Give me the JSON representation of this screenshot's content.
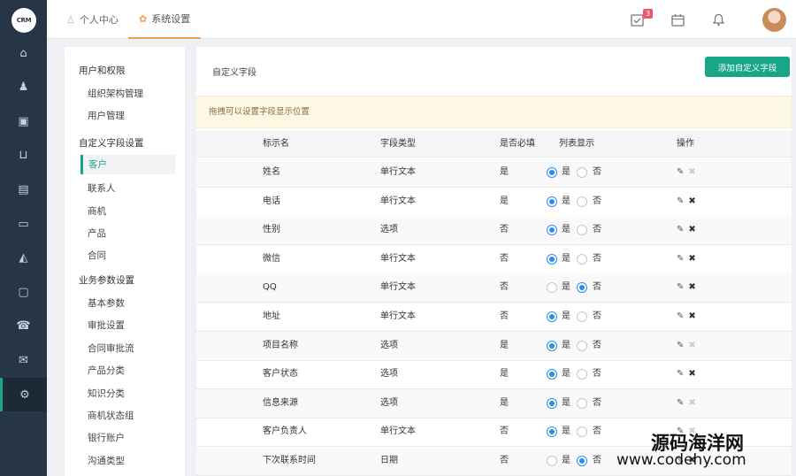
{
  "logo": "CRM",
  "topbar": {
    "tabs": [
      {
        "label": "个人中心",
        "icon": "user-icon"
      },
      {
        "label": "系统设置",
        "icon": "gear-icon"
      }
    ],
    "task_badge": "3",
    "icons": [
      "task-icon",
      "calendar-icon",
      "bell-icon"
    ]
  },
  "leftnav": [
    "home-icon",
    "user-icon",
    "briefcase-icon",
    "inbox-icon",
    "document-icon",
    "card-icon",
    "chart-icon",
    "monitor-icon",
    "phone-icon",
    "mail-icon",
    "gear-icon"
  ],
  "sidebar": {
    "groups": [
      {
        "title": "用户和权限",
        "items": [
          "组织架构管理",
          "用户管理"
        ]
      },
      {
        "title": "自定义字段设置",
        "items": [
          "客户",
          "联系人",
          "商机",
          "产品",
          "合同"
        ]
      },
      {
        "title": "业务参数设置",
        "items": [
          "基本参数",
          "审批设置",
          "合同审批流",
          "产品分类",
          "知识分类",
          "商机状态组",
          "银行账户",
          "沟通类型"
        ]
      }
    ],
    "selected": "客户"
  },
  "main": {
    "title": "自定义字段",
    "add_button": "添加自定义字段",
    "hint": "拖拽可以设置字段显示位置",
    "columns": [
      "标示名",
      "字段类型",
      "是否必填",
      "列表显示",
      "操作"
    ],
    "yes": "是",
    "no": "否",
    "rows": [
      {
        "name": "姓名",
        "type": "单行文本",
        "required": "是",
        "show": true,
        "deletable": false
      },
      {
        "name": "电话",
        "type": "单行文本",
        "required": "是",
        "show": true,
        "deletable": true
      },
      {
        "name": "性别",
        "type": "选项",
        "required": "否",
        "show": true,
        "deletable": true
      },
      {
        "name": "微信",
        "type": "单行文本",
        "required": "否",
        "show": true,
        "deletable": true
      },
      {
        "name": "QQ",
        "type": "单行文本",
        "required": "否",
        "show": false,
        "deletable": true
      },
      {
        "name": "地址",
        "type": "单行文本",
        "required": "否",
        "show": true,
        "deletable": true
      },
      {
        "name": "项目名称",
        "type": "选项",
        "required": "是",
        "show": true,
        "deletable": false
      },
      {
        "name": "客户状态",
        "type": "选项",
        "required": "是",
        "show": true,
        "deletable": true
      },
      {
        "name": "信息来源",
        "type": "选项",
        "required": "是",
        "show": true,
        "deletable": false
      },
      {
        "name": "客户负责人",
        "type": "单行文本",
        "required": "否",
        "show": true,
        "deletable": false
      },
      {
        "name": "下次联系时间",
        "type": "日期",
        "required": "否",
        "show": false,
        "deletable": true
      }
    ]
  },
  "watermark": {
    "line1": "源码海洋网",
    "line2": "www.codehy.com"
  }
}
